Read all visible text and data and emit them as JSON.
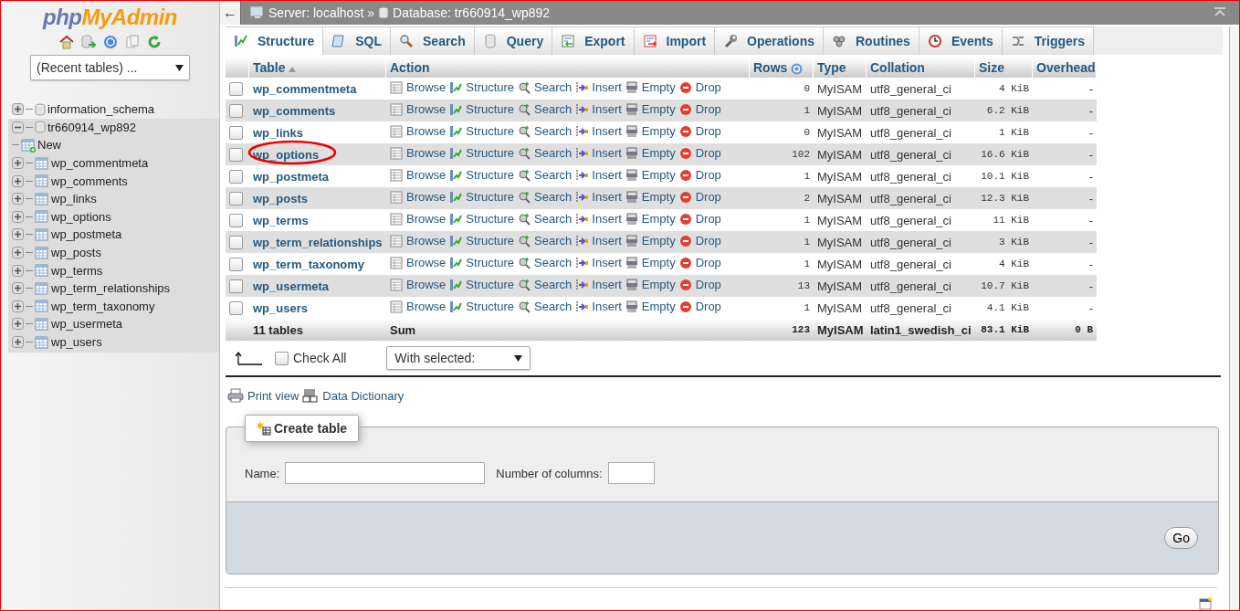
{
  "sidebar": {
    "logo": {
      "part_1": "php",
      "part_2": "MyAdmin"
    },
    "recent_tables": "(Recent tables) ...",
    "tree": [
      {
        "label": "information_schema",
        "expanded": false
      },
      {
        "label": "tr660914_wp892",
        "expanded": true,
        "children": [
          {
            "label": "New",
            "kind": "new"
          },
          {
            "label": "wp_commentmeta",
            "kind": "table"
          },
          {
            "label": "wp_comments",
            "kind": "table"
          },
          {
            "label": "wp_links",
            "kind": "table"
          },
          {
            "label": "wp_options",
            "kind": "table"
          },
          {
            "label": "wp_postmeta",
            "kind": "table"
          },
          {
            "label": "wp_posts",
            "kind": "table"
          },
          {
            "label": "wp_terms",
            "kind": "table"
          },
          {
            "label": "wp_term_relationships",
            "kind": "table"
          },
          {
            "label": "wp_term_taxonomy",
            "kind": "table"
          },
          {
            "label": "wp_usermeta",
            "kind": "table"
          },
          {
            "label": "wp_users",
            "kind": "table"
          }
        ]
      }
    ]
  },
  "breadcrumb": {
    "back": "←",
    "server": "Server: localhost",
    "separator": "»",
    "database": "Database: tr660914_wp892"
  },
  "tabs": [
    {
      "label": "Structure",
      "selected": true
    },
    {
      "label": "SQL",
      "selected": false
    },
    {
      "label": "Search",
      "selected": false
    },
    {
      "label": "Query",
      "selected": false
    },
    {
      "label": "Export",
      "selected": false
    },
    {
      "label": "Import",
      "selected": false
    },
    {
      "label": "Operations",
      "selected": false
    },
    {
      "label": "Routines",
      "selected": false
    },
    {
      "label": "Events",
      "selected": false
    },
    {
      "label": "Triggers",
      "selected": false
    }
  ],
  "table": {
    "columns": [
      "Table",
      "Action",
      "Rows",
      "Type",
      "Collation",
      "Size",
      "Overhead"
    ],
    "rows": [
      {
        "name": "wp_commentmeta",
        "checked": false,
        "highlighted": false,
        "actions": [
          "Browse",
          "Structure",
          "Search",
          "Insert",
          "Empty",
          "Drop"
        ],
        "rows": "0",
        "type": "MyISAM",
        "collation": "utf8_general_ci",
        "size": "4 KiB",
        "overhead": "-"
      },
      {
        "name": "wp_comments",
        "checked": false,
        "highlighted": false,
        "actions": [
          "Browse",
          "Structure",
          "Search",
          "Insert",
          "Empty",
          "Drop"
        ],
        "rows": "1",
        "type": "MyISAM",
        "collation": "utf8_general_ci",
        "size": "6.2 KiB",
        "overhead": "-"
      },
      {
        "name": "wp_links",
        "checked": false,
        "highlighted": false,
        "actions": [
          "Browse",
          "Structure",
          "Search",
          "Insert",
          "Empty",
          "Drop"
        ],
        "rows": "0",
        "type": "MyISAM",
        "collation": "utf8_general_ci",
        "size": "1 KiB",
        "overhead": "-"
      },
      {
        "name": "wp_options",
        "checked": false,
        "highlighted": true,
        "actions": [
          "Browse",
          "Structure",
          "Search",
          "Insert",
          "Empty",
          "Drop"
        ],
        "rows": "102",
        "type": "MyISAM",
        "collation": "utf8_general_ci",
        "size": "16.6 KiB",
        "overhead": "-"
      },
      {
        "name": "wp_postmeta",
        "checked": false,
        "highlighted": false,
        "actions": [
          "Browse",
          "Structure",
          "Search",
          "Insert",
          "Empty",
          "Drop"
        ],
        "rows": "1",
        "type": "MyISAM",
        "collation": "utf8_general_ci",
        "size": "10.1 KiB",
        "overhead": "-"
      },
      {
        "name": "wp_posts",
        "checked": false,
        "highlighted": false,
        "actions": [
          "Browse",
          "Structure",
          "Search",
          "Insert",
          "Empty",
          "Drop"
        ],
        "rows": "2",
        "type": "MyISAM",
        "collation": "utf8_general_ci",
        "size": "12.3 KiB",
        "overhead": "-"
      },
      {
        "name": "wp_terms",
        "checked": false,
        "highlighted": false,
        "actions": [
          "Browse",
          "Structure",
          "Search",
          "Insert",
          "Empty",
          "Drop"
        ],
        "rows": "1",
        "type": "MyISAM",
        "collation": "utf8_general_ci",
        "size": "11 KiB",
        "overhead": "-"
      },
      {
        "name": "wp_term_relationships",
        "checked": false,
        "highlighted": false,
        "actions": [
          "Browse",
          "Structure",
          "Search",
          "Insert",
          "Empty",
          "Drop"
        ],
        "rows": "1",
        "type": "MyISAM",
        "collation": "utf8_general_ci",
        "size": "3 KiB",
        "overhead": "-"
      },
      {
        "name": "wp_term_taxonomy",
        "checked": false,
        "highlighted": false,
        "actions": [
          "Browse",
          "Structure",
          "Search",
          "Insert",
          "Empty",
          "Drop"
        ],
        "rows": "1",
        "type": "MyISAM",
        "collation": "utf8_general_ci",
        "size": "4 KiB",
        "overhead": "-"
      },
      {
        "name": "wp_usermeta",
        "checked": false,
        "highlighted": false,
        "actions": [
          "Browse",
          "Structure",
          "Search",
          "Insert",
          "Empty",
          "Drop"
        ],
        "rows": "13",
        "type": "MyISAM",
        "collation": "utf8_general_ci",
        "size": "10.7 KiB",
        "overhead": "-"
      },
      {
        "name": "wp_users",
        "checked": false,
        "highlighted": false,
        "actions": [
          "Browse",
          "Structure",
          "Search",
          "Insert",
          "Empty",
          "Drop"
        ],
        "rows": "1",
        "type": "MyISAM",
        "collation": "utf8_general_ci",
        "size": "4.1 KiB",
        "overhead": "-"
      }
    ],
    "footer": {
      "name": "11 tables",
      "action": "Sum",
      "rows": "123",
      "type": "MyISAM",
      "collation": "latin1_swedish_ci",
      "size": "83.1 KiB",
      "overhead": "0 B"
    }
  },
  "bulk": {
    "check_all": "Check All",
    "checked": false,
    "with_selected": "With selected:"
  },
  "links": [
    "Print view",
    "Data Dictionary"
  ],
  "create_table": {
    "legend": "Create table",
    "name_label": "Name:",
    "columns_label": "Number of columns:",
    "go": "Go"
  }
}
